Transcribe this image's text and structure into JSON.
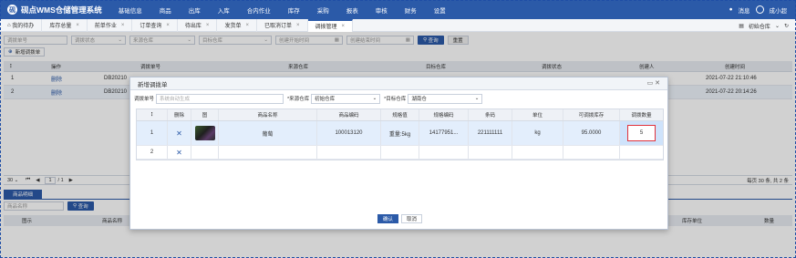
{
  "app": {
    "title": "砚点WMS仓储管理系统",
    "logo_glyph": "砚"
  },
  "topnav": {
    "items": [
      "基础信息",
      "商品",
      "出库",
      "入库",
      "合内作业",
      "库存",
      "采购",
      "报表",
      "审核",
      "财务",
      "设置"
    ],
    "message_label": "消息",
    "user_label": "成小超"
  },
  "tabs": {
    "items": [
      {
        "label": "我的待办",
        "closable": false
      },
      {
        "label": "库存总量",
        "closable": true
      },
      {
        "label": "前单作业",
        "closable": true
      },
      {
        "label": "订单查询",
        "closable": true
      },
      {
        "label": "待出库",
        "closable": true
      },
      {
        "label": "发货单",
        "closable": true
      },
      {
        "label": "已取消订单",
        "closable": true
      },
      {
        "label": "调拨管理",
        "closable": true
      }
    ],
    "active_index": 7,
    "warehouse_label": "初始仓库"
  },
  "filters": {
    "transfer_no_placeholder": "调拨单号",
    "status_placeholder": "调拨状态",
    "source_wh_placeholder": "来源仓库",
    "target_wh_placeholder": "目标仓库",
    "start_time_placeholder": "创建开始时间",
    "end_time_placeholder": "创建结束时间",
    "search_label": "查询",
    "reset_label": "重置",
    "new_label": "新增调拨单"
  },
  "grid": {
    "headers": [
      "操作",
      "调拨单号",
      "来源仓库",
      "目标仓库",
      "调拨状态",
      "创建人",
      "创建时间"
    ],
    "rows": [
      {
        "no": "1",
        "op": "删除",
        "code": "DB20210",
        "time": "2021-07-22 21:10:46"
      },
      {
        "no": "2",
        "op": "删除",
        "code": "DB20210",
        "time": "2021-07-22 20:14:26"
      }
    ]
  },
  "pager": {
    "page_size": "30",
    "page_input": "1",
    "page_total": "/ 1",
    "summary": "每页 30 条, 共 2 条"
  },
  "detail": {
    "tab_label": "商品明细",
    "search_placeholder": "商品名称",
    "search_label": "查询",
    "headers": [
      "图示",
      "商品名称",
      "库存单位",
      "数量"
    ]
  },
  "modal": {
    "title": "新增调拨单",
    "controls": "▭ ✕",
    "form": {
      "transfer_no_label": "调拨单号",
      "transfer_no_placeholder": "系统自动生成",
      "source_label": "*来源仓库",
      "source_value": "初始仓库",
      "target_label": "*目标仓库",
      "target_value": "湖南仓"
    },
    "headers": [
      "删除",
      "图",
      "商品名称",
      "商品编码",
      "规格值",
      "规格编码",
      "条码",
      "单位",
      "可调拨库存",
      "调拨数量"
    ],
    "rows": [
      {
        "no": "1",
        "name": "葡萄",
        "code": "100013120",
        "spec": "重量:5kg",
        "spec_code": "14177951...",
        "barcode": "221111111",
        "unit": "kg",
        "stock": "95.0000",
        "qty": "5"
      },
      {
        "no": "2"
      }
    ],
    "ok_label": "确认",
    "cancel_label": "取消"
  },
  "colors": {
    "brand": "#2b5aa8",
    "highlight_row": "#e3eefc",
    "qty_border": "#e0323c"
  }
}
